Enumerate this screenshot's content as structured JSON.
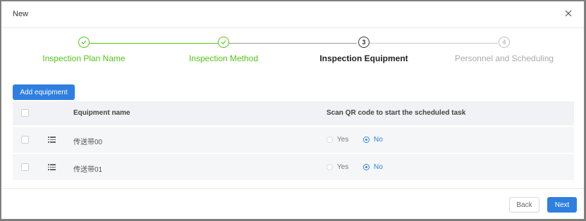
{
  "dialog": {
    "title": "New"
  },
  "steps": [
    {
      "number": "1",
      "label": "Inspection Plan Name",
      "status": "done"
    },
    {
      "number": "2",
      "label": "Inspection Method",
      "status": "done"
    },
    {
      "number": "3",
      "label": "Inspection Equipment",
      "status": "active"
    },
    {
      "number": "4",
      "label": "Personnel and Scheduling",
      "status": "wait"
    }
  ],
  "toolbar": {
    "add_equipment": "Add equipment"
  },
  "table": {
    "columns": {
      "name": "Equipment name",
      "scan": "Scan QR code to start the scheduled task"
    },
    "rows": [
      {
        "name": "传送带00",
        "yes": "Yes",
        "no": "No",
        "selected": "No"
      },
      {
        "name": "传送带01",
        "yes": "Yes",
        "no": "No",
        "selected": "No"
      }
    ]
  },
  "footer": {
    "back": "Back",
    "next": "Next"
  },
  "colors": {
    "primary": "#2f7fe0",
    "success": "#52c41a"
  }
}
